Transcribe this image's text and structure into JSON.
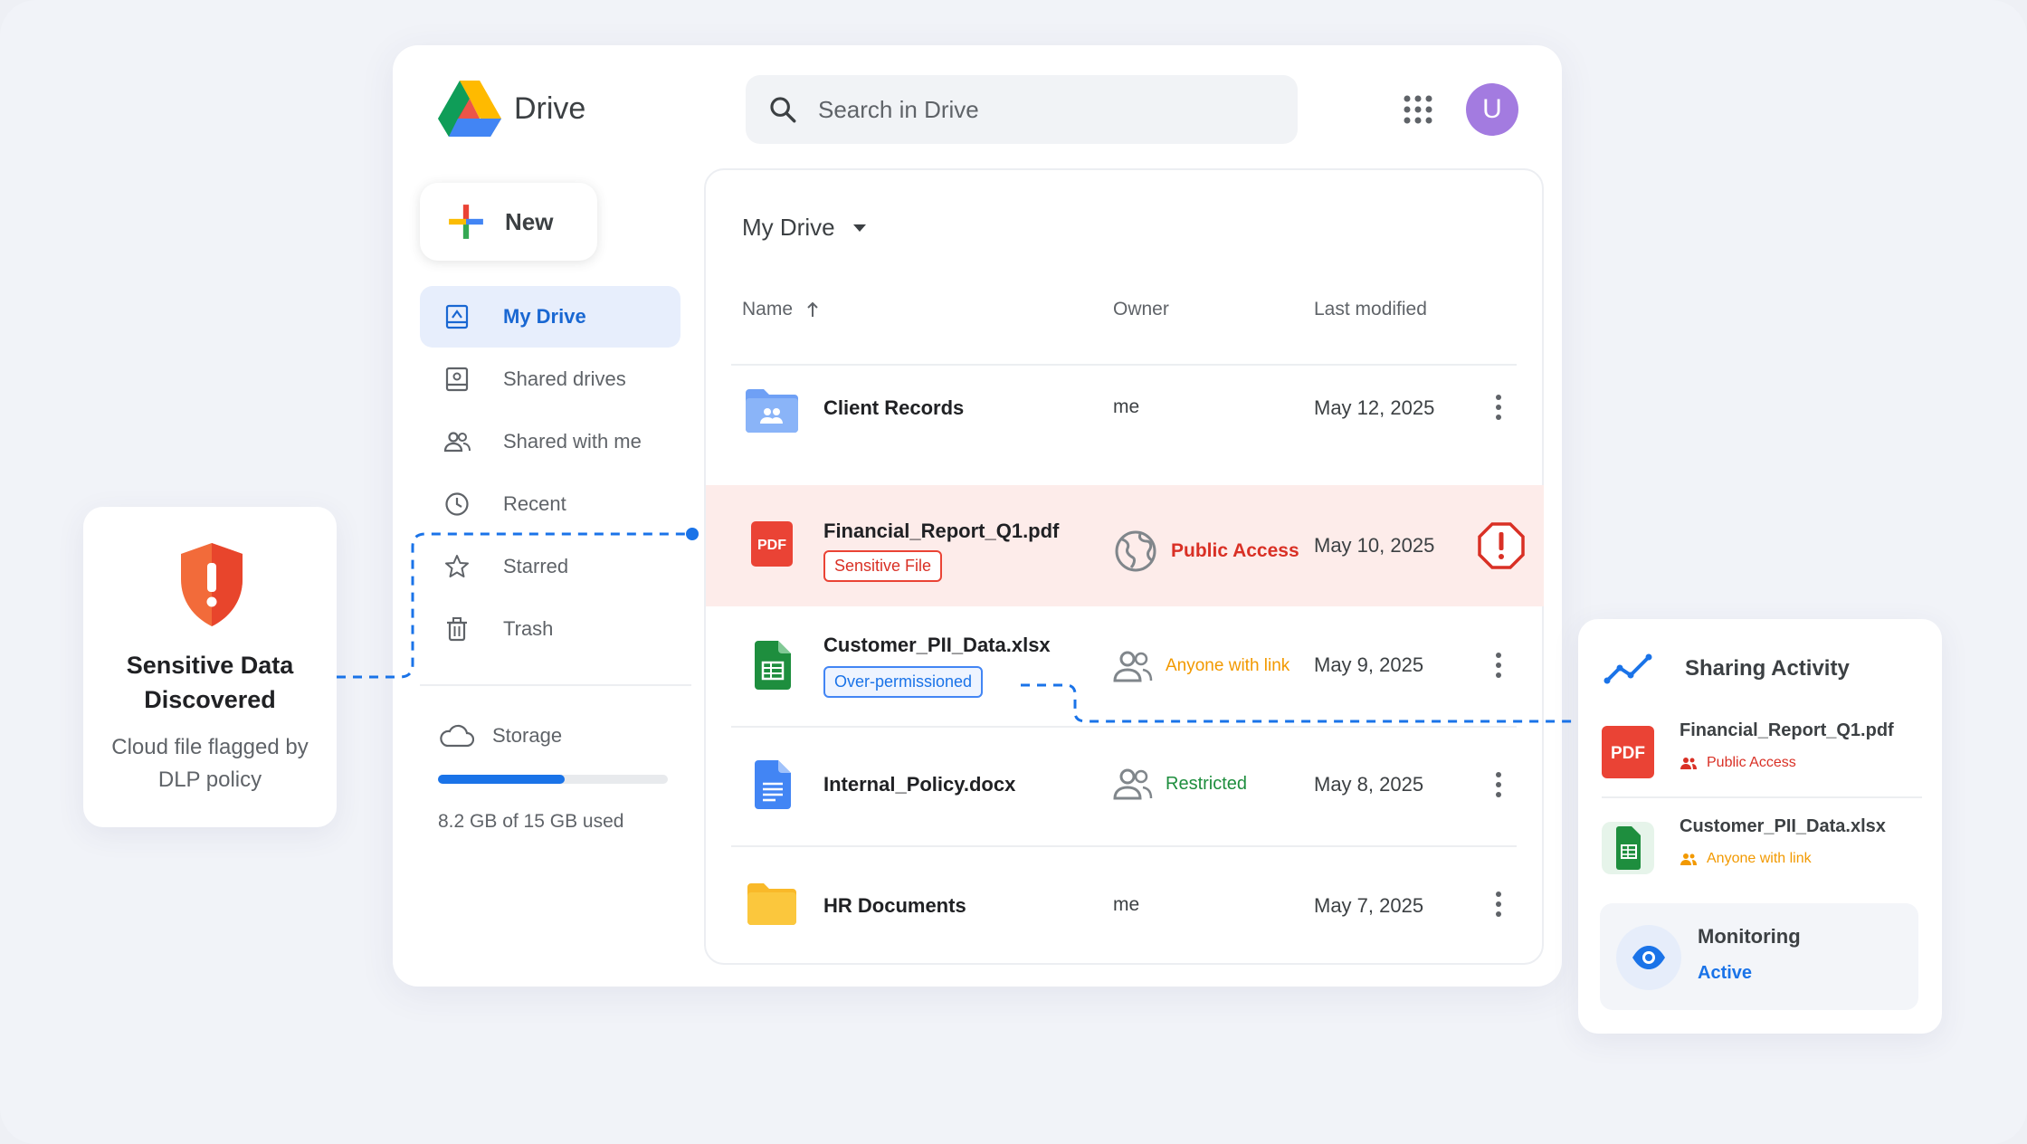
{
  "app": {
    "name": "Drive"
  },
  "search": {
    "placeholder": "Search in Drive"
  },
  "user": {
    "avatar_letter": "U",
    "avatar_color": "#a37be0"
  },
  "sidebar": {
    "new_label": "New",
    "items": [
      {
        "label": "My Drive",
        "icon": "my-drive-icon",
        "active": true
      },
      {
        "label": "Shared drives",
        "icon": "shared-drives-icon"
      },
      {
        "label": "Shared with me",
        "icon": "people-icon"
      },
      {
        "label": "Recent",
        "icon": "clock-icon"
      },
      {
        "label": "Starred",
        "icon": "star-icon"
      },
      {
        "label": "Trash",
        "icon": "trash-icon"
      }
    ],
    "storage": {
      "label": "Storage",
      "used_text": "8.2 GB of 15 GB used",
      "fraction": 0.55
    }
  },
  "main": {
    "breadcrumb": "My Drive",
    "columns": {
      "name": "Name",
      "owner": "Owner",
      "modified": "Last modified"
    },
    "files": [
      {
        "name": "Client Records",
        "type": "shared-folder",
        "owner": "me",
        "modified": "May 12, 2025"
      },
      {
        "name": "Financial_Report_Q1.pdf",
        "type": "pdf",
        "file_badge": "PDF",
        "tag": "Sensitive File",
        "owner": "Public Access",
        "owner_color": "#d93025",
        "modified": "May 10, 2025",
        "alert": true
      },
      {
        "name": "Customer_PII_Data.xlsx",
        "type": "sheet",
        "tag": "Over-permissioned",
        "owner": "Anyone with link",
        "owner_color": "#f29900",
        "modified": "May 9, 2025"
      },
      {
        "name": "Internal_Policy.docx",
        "type": "doc",
        "owner": "Restricted",
        "owner_color": "#1e8e3e",
        "modified": "May 8, 2025"
      },
      {
        "name": "HR Documents",
        "type": "folder",
        "owner": "me",
        "modified": "May 7, 2025"
      }
    ]
  },
  "alert_card": {
    "title": "Sensitive Data Discovered",
    "subtitle": "Cloud file flagged by DLP policy",
    "accent": "#ea4335"
  },
  "activity_card": {
    "title": "Sharing Activity",
    "items": [
      {
        "name": "Financial_Report_Q1.pdf",
        "status": "Public Access",
        "status_color": "#d93025",
        "badge": "PDF"
      },
      {
        "name": "Customer_PII_Data.xlsx",
        "status": "Anyone with link",
        "status_color": "#f29900"
      }
    ],
    "monitoring": {
      "title": "Monitoring",
      "status": "Active"
    }
  },
  "colors": {
    "accent": "#1a73e8",
    "danger_row": "#fdecea"
  }
}
